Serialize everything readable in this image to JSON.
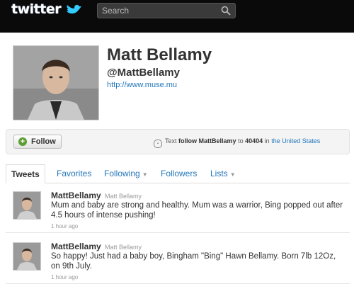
{
  "header": {
    "logo_text": "twitter",
    "search": {
      "placeholder": "Search"
    }
  },
  "profile": {
    "name": "Matt Bellamy",
    "handle": "@MattBellamy",
    "url": "http://www.muse.mu"
  },
  "actions": {
    "follow_label": "Follow",
    "text_follow": {
      "prefix": "Text",
      "follow_word": "follow",
      "username": "MattBellamy",
      "to": "to",
      "number": "40404",
      "in": "in",
      "country": "the United States"
    }
  },
  "tabs": [
    {
      "label": "Tweets",
      "active": true
    },
    {
      "label": "Favorites"
    },
    {
      "label": "Following"
    },
    {
      "label": "Followers"
    },
    {
      "label": "Lists"
    }
  ],
  "tweets": [
    {
      "username": "MattBellamy",
      "fullname": "Matt Bellamy",
      "text": "Mum and baby are strong and healthy. Mum was a warrior, Bing popped out after 4.5 hours of intense pushing!",
      "time": "1 hour ago"
    },
    {
      "username": "MattBellamy",
      "fullname": "Matt Bellamy",
      "text": "So happy! Just had a baby boy, Bingham \"Bing\" Hawn Bellamy. Born 7lb 12Oz, on 9th July.",
      "time": "1 hour ago"
    }
  ],
  "colors": {
    "topbar": "#0a0a0a",
    "link": "#2276bb",
    "follow_green": "#5c9e32"
  }
}
